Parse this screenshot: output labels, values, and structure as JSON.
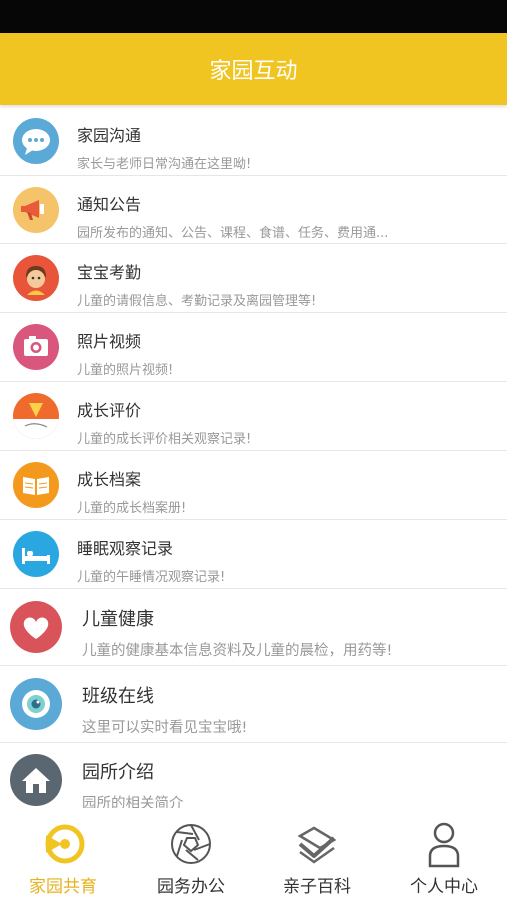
{
  "header": {
    "title": "家园互动"
  },
  "menu": [
    {
      "title": "家园沟通",
      "desc": "家长与老师日常沟通在这里呦!",
      "icon": "chat-bubble-icon",
      "color": "#5aa9d6"
    },
    {
      "title": "通知公告",
      "desc": "园所发布的通知、公告、课程、食谱、任务、费用通...",
      "icon": "megaphone-icon",
      "color": "#f5c46a"
    },
    {
      "title": "宝宝考勤",
      "desc": "儿童的请假信息、考勤记录及离园管理等!",
      "icon": "child-face-icon",
      "color": "#e8553a"
    },
    {
      "title": "照片视频",
      "desc": "儿童的照片视频!",
      "icon": "camera-icon",
      "color": "#d9577c"
    },
    {
      "title": "成长评价",
      "desc": "儿童的成长评价相关观察记录!",
      "icon": "growth-evaluation-icon",
      "color": "#f06a2e"
    },
    {
      "title": "成长档案",
      "desc": "儿童的成长档案册!",
      "icon": "open-book-icon",
      "color": "#f39a1e"
    },
    {
      "title": "睡眠观察记录",
      "desc": "儿童的午睡情况观察记录!",
      "icon": "bed-icon",
      "color": "#2aa7e0"
    },
    {
      "title": "儿童健康",
      "desc": "儿童的健康基本信息资料及儿童的晨检，用药等!",
      "icon": "heart-icon",
      "color": "#d9545a"
    },
    {
      "title": "班级在线",
      "desc": "这里可以实时看见宝宝哦!",
      "icon": "eye-icon",
      "color": "#5aa9d6"
    },
    {
      "title": "园所介绍",
      "desc": "园所的相关简介",
      "icon": "house-icon",
      "color": "#5b6770"
    }
  ],
  "tabs": [
    {
      "label": "家园共育",
      "icon": "family-tab-icon",
      "active": true
    },
    {
      "label": "园务办公",
      "icon": "aperture-tab-icon",
      "active": false
    },
    {
      "label": "亲子百科",
      "icon": "checkmark-tab-icon",
      "active": false
    },
    {
      "label": "个人中心",
      "icon": "person-tab-icon",
      "active": false
    }
  ],
  "colors": {
    "accent": "#f0c522",
    "active_tab": "#e6b21c"
  }
}
